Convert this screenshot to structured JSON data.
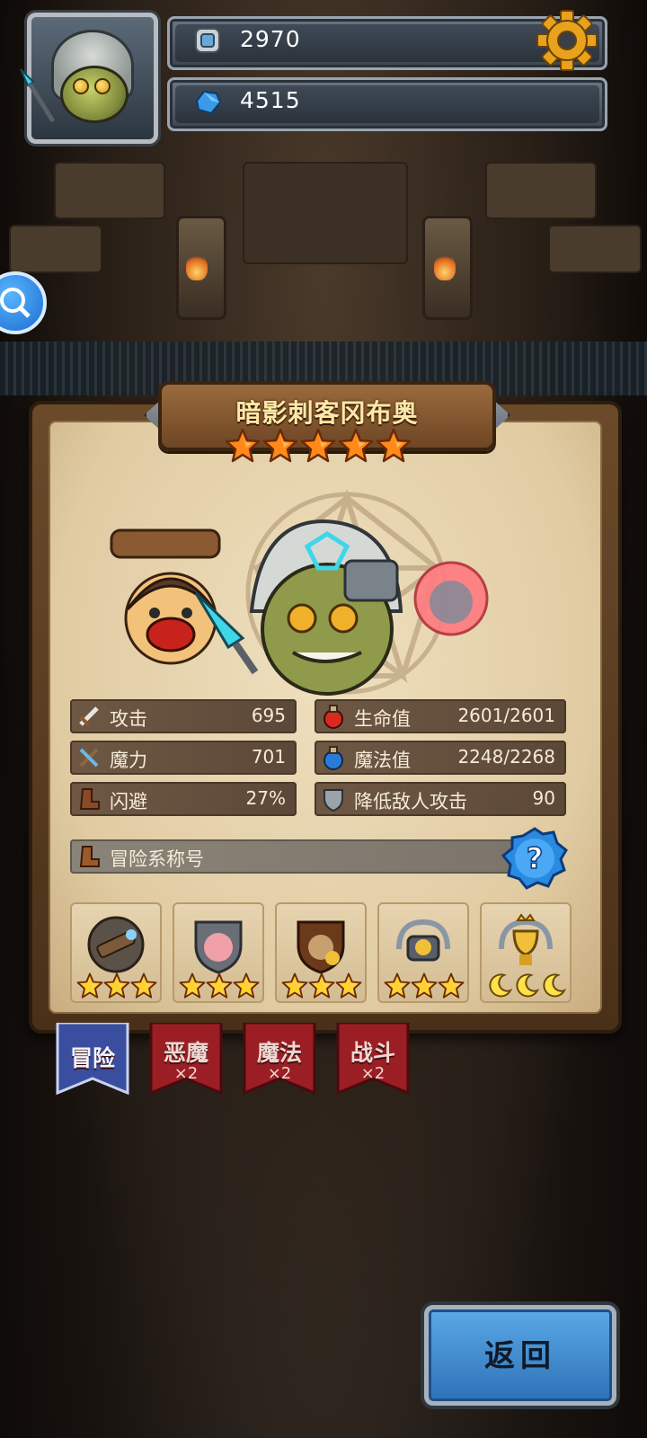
{
  "hud": {
    "resources": [
      {
        "icon": "silver-coin-icon",
        "value": "2970"
      },
      {
        "icon": "blue-gem-icon",
        "value": "4515"
      }
    ],
    "settings_icon": "gear-icon",
    "side_icon": "magnifier-icon"
  },
  "hero": {
    "name": "暗影刺客冈布奥",
    "stars": 5
  },
  "stats": [
    {
      "icon": "sword-icon",
      "label": "攻击",
      "value": "695"
    },
    {
      "icon": "red-potion-icon",
      "label": "生命值",
      "value": "2601/2601"
    },
    {
      "icon": "magic-staff-icon",
      "label": "魔力",
      "value": "701"
    },
    {
      "icon": "blue-potion-icon",
      "label": "魔法值",
      "value": "2248/2268"
    },
    {
      "icon": "boot-icon",
      "label": "闪避",
      "value": "27%"
    },
    {
      "icon": "shield-icon",
      "label": "降低敌人攻击",
      "value": "90"
    }
  ],
  "title_section": {
    "label": "冒险系称号",
    "help_icon": "question-icon"
  },
  "badges": [
    {
      "icon": "telescope-badge-icon",
      "rating": 3,
      "rating_icon": "star"
    },
    {
      "icon": "pig-shield-badge-icon",
      "rating": 3,
      "rating_icon": "star"
    },
    {
      "icon": "treasure-bag-badge-icon",
      "rating": 3,
      "rating_icon": "star"
    },
    {
      "icon": "gold-pile-laurel-badge-icon",
      "rating": 3,
      "rating_icon": "star"
    },
    {
      "icon": "golden-trophy-badge-icon",
      "rating": 3,
      "rating_icon": "moon"
    }
  ],
  "tabs": [
    {
      "label": "冒险",
      "sub": "",
      "active": true
    },
    {
      "label": "恶魔",
      "sub": "×2",
      "active": false
    },
    {
      "label": "魔法",
      "sub": "×2",
      "active": false
    },
    {
      "label": "战斗",
      "sub": "×2",
      "active": false
    }
  ],
  "back_button": {
    "label": "返回"
  },
  "colors": {
    "active_tab": "#3a4ea0",
    "inactive_tab": "#9a1e24",
    "star": "#ff8a1a",
    "back_button": "#3a8ad2"
  }
}
